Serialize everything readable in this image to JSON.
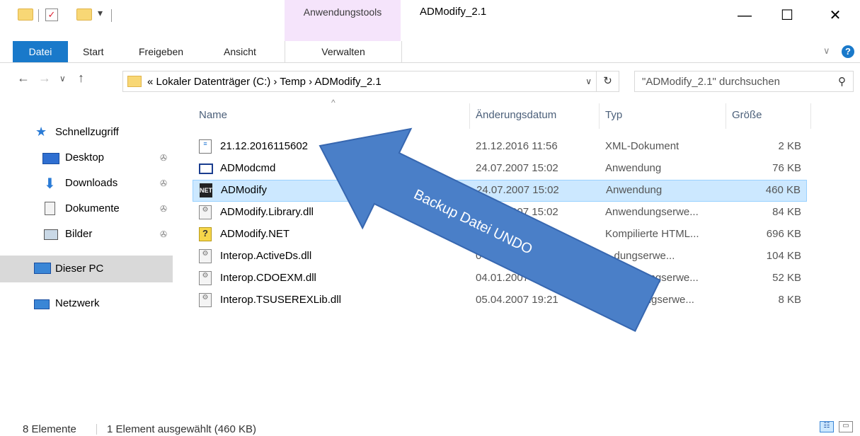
{
  "window": {
    "title": "ADModify_2.1",
    "contextual_group": "Anwendungstools",
    "minimize_glyph": "—",
    "maximize_glyph": "☐",
    "close_glyph": "✕"
  },
  "ribbon": {
    "tabs": [
      "Datei",
      "Start",
      "Freigeben",
      "Ansicht",
      "Verwalten"
    ],
    "help_glyph": "?",
    "collapse_glyph": "∨"
  },
  "address": {
    "path_text": "«  Lokaler Datenträger (C:)  ›  Temp  ›  ADModify_2.1",
    "search_placeholder": "\"ADModify_2.1\" durchsuchen"
  },
  "sidebar": {
    "items": [
      {
        "label": "Schnellzugriff",
        "icon": "star-icon"
      },
      {
        "label": "Desktop",
        "icon": "desktop-icon",
        "pinned": true
      },
      {
        "label": "Downloads",
        "icon": "download-arrow-icon",
        "pinned": true
      },
      {
        "label": "Dokumente",
        "icon": "document-icon",
        "pinned": true
      },
      {
        "label": "Bilder",
        "icon": "picture-icon",
        "pinned": true
      },
      {
        "label": "Dieser PC",
        "icon": "computer-icon"
      },
      {
        "label": "Netzwerk",
        "icon": "network-icon"
      }
    ]
  },
  "file_list": {
    "columns": [
      "Name",
      "Änderungsdatum",
      "Typ",
      "Größe"
    ],
    "rows": [
      {
        "name": "21.12.2016115602",
        "date": "21.12.2016 11:56",
        "type": "XML-Dokument",
        "size": "2 KB",
        "icon": "xml-file-icon"
      },
      {
        "name": "ADModcmd",
        "date": "24.07.2007 15:02",
        "type": "Anwendung",
        "size": "76 KB",
        "icon": "console-app-icon"
      },
      {
        "name": "ADModify",
        "date": "24.07.2007 15:02",
        "type": "Anwendung",
        "size": "460 KB",
        "icon": "net-app-icon",
        "selected": true
      },
      {
        "name": "ADModify.Library.dll",
        "date": "24.07.2007 15:02",
        "type": "Anwendungserwe...",
        "size": "84 KB",
        "icon": "dll-file-icon"
      },
      {
        "name": "ADModify.NET",
        "date": "",
        "type": "Kompilierte HTML...",
        "size": "696 KB",
        "icon": "chm-file-icon"
      },
      {
        "name": "Interop.ActiveDs.dll",
        "date": "04.01.",
        "type": "...dungserwe...",
        "size": "104 KB",
        "icon": "dll-file-icon"
      },
      {
        "name": "Interop.CDOEXM.dll",
        "date": "04.01.2007 18:...",
        "type": "Anwendungserwe...",
        "size": "52 KB",
        "icon": "dll-file-icon"
      },
      {
        "name": "Interop.TSUSEREXLib.dll",
        "date": "05.04.2007 19:21",
        "type": "...wendungserwe...",
        "size": "8 KB",
        "icon": "dll-file-icon"
      }
    ]
  },
  "annotation": {
    "text": "Backup Datei UNDO",
    "color": "#4a7fc8"
  },
  "status": {
    "count": "8 Elemente",
    "selection": "1 Element ausgewählt (460 KB)"
  },
  "colors": {
    "accent": "#1979ca",
    "context_tab": "#f5e4fb",
    "selection": "#cce8ff"
  }
}
